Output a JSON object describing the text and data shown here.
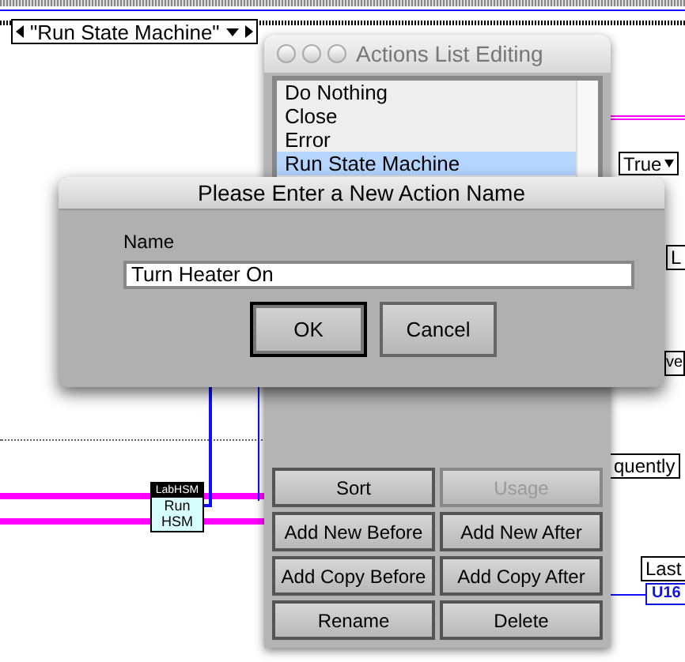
{
  "diagram": {
    "case_selector": "\"Run State Machine\"",
    "node": {
      "header": "LabHSM",
      "lines": [
        "Run",
        "HSM"
      ]
    },
    "fragments": [
      {
        "kind": "dropdown",
        "text": "True"
      },
      {
        "kind": "label",
        "text": "L"
      },
      {
        "kind": "label",
        "text": "ve"
      },
      {
        "kind": "label",
        "text": "quently"
      },
      {
        "kind": "label",
        "text": "Last"
      },
      {
        "kind": "numeric",
        "text": "U16"
      }
    ]
  },
  "actions_window": {
    "title": "Actions List Editing",
    "items": [
      {
        "label": "Do Nothing",
        "selected": false
      },
      {
        "label": "Close",
        "selected": false
      },
      {
        "label": "Error",
        "selected": false
      },
      {
        "label": "Run State Machine",
        "selected": true
      }
    ],
    "buttons": [
      {
        "label": "Sort",
        "disabled": false
      },
      {
        "label": "Usage",
        "disabled": true
      },
      {
        "label": "Add New Before",
        "disabled": false
      },
      {
        "label": "Add New After",
        "disabled": false
      },
      {
        "label": "Add Copy Before",
        "disabled": false
      },
      {
        "label": "Add Copy After",
        "disabled": false
      },
      {
        "label": "Rename",
        "disabled": false
      },
      {
        "label": "Delete",
        "disabled": false
      }
    ]
  },
  "dialog": {
    "title": "Please Enter a New Action Name",
    "field_label": "Name",
    "value": "Turn Heater On",
    "buttons": [
      {
        "label": "OK",
        "default": true
      },
      {
        "label": "Cancel",
        "default": false
      }
    ]
  }
}
